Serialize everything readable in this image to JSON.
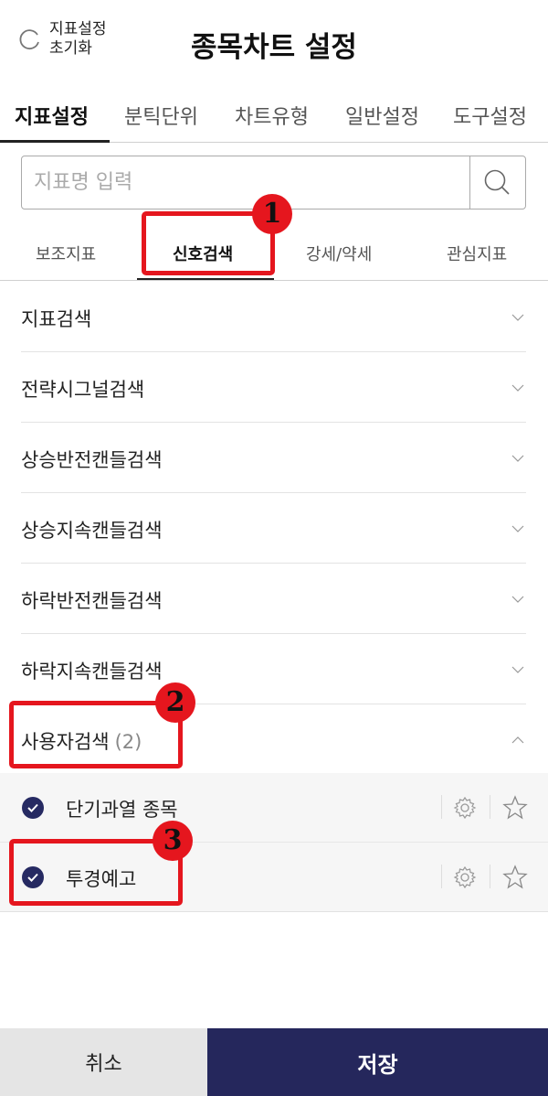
{
  "header": {
    "reset_label": "지표설정\n초기화",
    "title": "종목차트 설정"
  },
  "tabs": [
    {
      "label": "지표설정",
      "active": true
    },
    {
      "label": "분틱단위",
      "active": false
    },
    {
      "label": "차트유형",
      "active": false
    },
    {
      "label": "일반설정",
      "active": false
    },
    {
      "label": "도구설정",
      "active": false
    }
  ],
  "search": {
    "placeholder": "지표명 입력",
    "value": "",
    "icon": "search-icon"
  },
  "subtabs": [
    {
      "label": "보조지표",
      "active": false
    },
    {
      "label": "신호검색",
      "active": true
    },
    {
      "label": "강세/약세",
      "active": false
    },
    {
      "label": "관심지표",
      "active": false
    }
  ],
  "categories": [
    {
      "label": "지표검색",
      "count": "",
      "expanded": false
    },
    {
      "label": "전략시그널검색",
      "count": "",
      "expanded": false
    },
    {
      "label": "상승반전캔들검색",
      "count": "",
      "expanded": false
    },
    {
      "label": "상승지속캔들검색",
      "count": "",
      "expanded": false
    },
    {
      "label": "하락반전캔들검색",
      "count": "",
      "expanded": false
    },
    {
      "label": "하락지속캔들검색",
      "count": "",
      "expanded": false
    },
    {
      "label": "사용자검색",
      "count": "(2)",
      "expanded": true
    }
  ],
  "user_items": [
    {
      "label": "단기과열 종목",
      "checked": true
    },
    {
      "label": "투경예고",
      "checked": true
    }
  ],
  "annotations": [
    "1",
    "2",
    "3"
  ],
  "buttons": {
    "cancel": "취소",
    "save": "저장"
  },
  "colors": {
    "accent_navy": "#25275c",
    "highlight_red": "#e5161e",
    "check_navy": "#262a62"
  }
}
